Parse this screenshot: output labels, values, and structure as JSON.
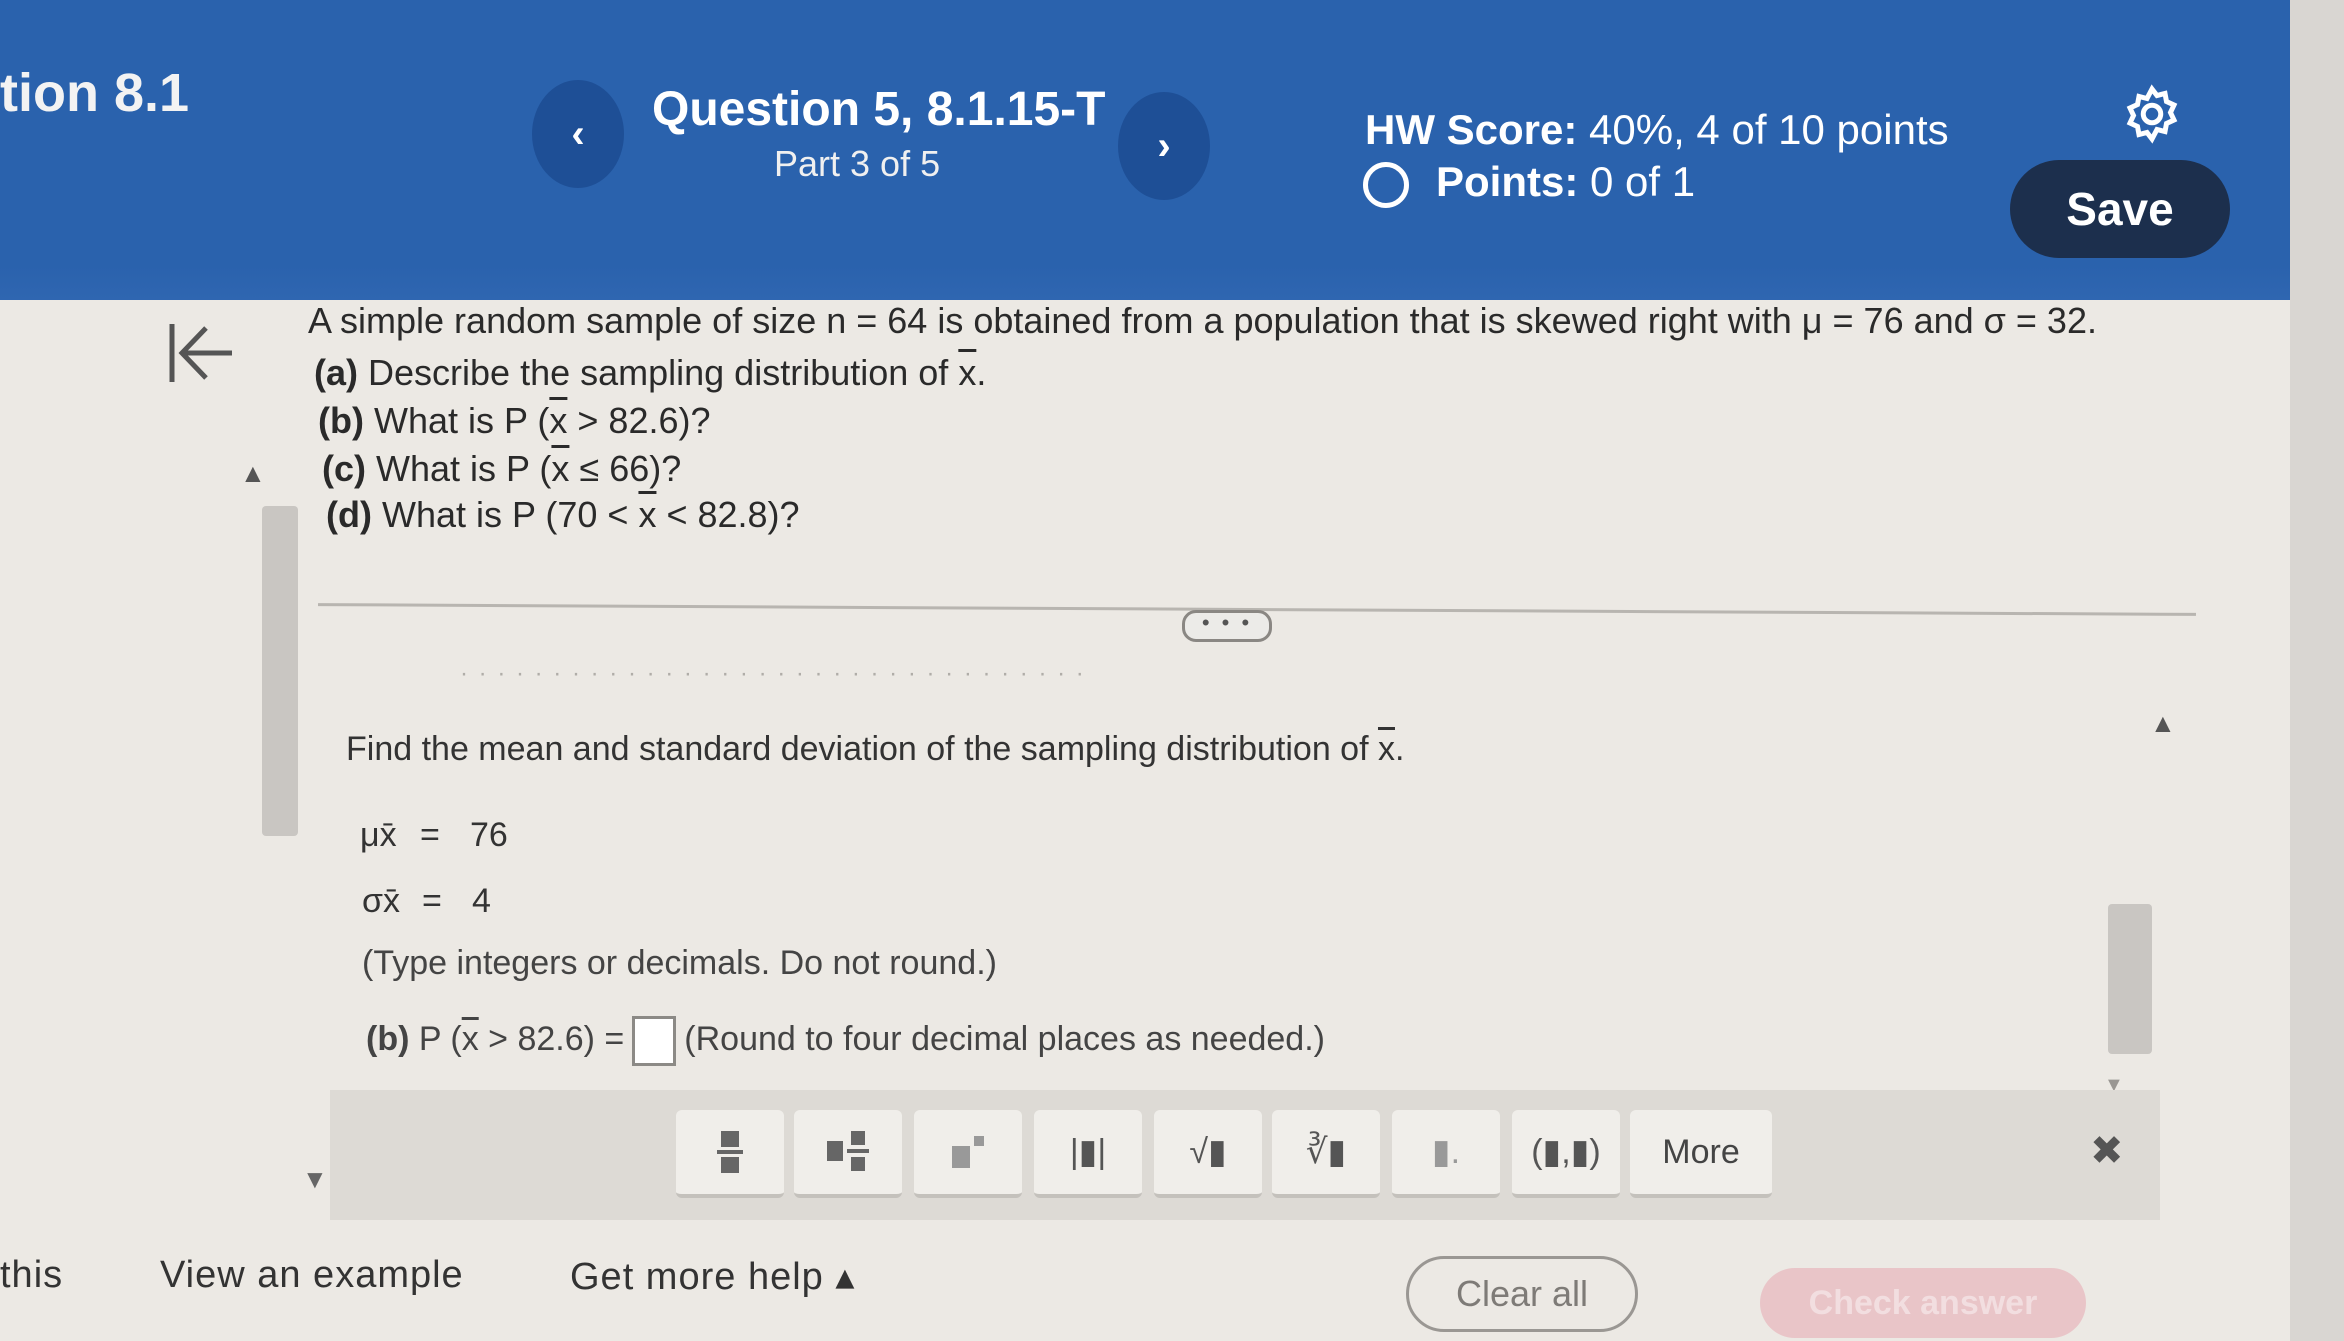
{
  "header": {
    "section_title": "tion 8.1",
    "question_title": "Question 5, 8.1.15-T",
    "part": "Part 3 of 5",
    "prev_label": "‹",
    "next_label": "›",
    "hw_score_label": "HW Score:",
    "hw_score_value": "40%, 4 of 10 points",
    "points_label": "Points:",
    "points_value": "0 of 1",
    "save_label": "Save",
    "settings_icon": "gear-icon",
    "color": "#2a62ad"
  },
  "question": {
    "intro": "A simple random sample of size n = 64 is obtained from a population that is skewed right with μ = 76 and σ = 32.",
    "part_a_label": "(a)",
    "part_a_text_1": "Describe the sampling distribution of",
    "part_a_x": "x",
    "part_a_text_2": ".",
    "part_b_label": "(b)",
    "part_b_text_1": "What is P",
    "part_b_open": "(",
    "part_b_x": "x",
    "part_b_text_2": "> 82.6)?",
    "part_c_label": "(c)",
    "part_c_text_1": "What is P",
    "part_c_open": "(",
    "part_c_x": "x",
    "part_c_text_2": "≤ 66)?",
    "part_d_label": "(d)",
    "part_d_text_1": "What is P (70 <",
    "part_d_x": "x",
    "part_d_text_2": "< 82.8)?"
  },
  "expand_handle": "• • •",
  "faded_line": "· · ·  · · · · · ·  · ·  · · ·  · · · · · · · · · ·  · ·  · · · · · · · ·",
  "answer": {
    "find_text_1": "Find the mean and standard deviation of the sampling distribution of",
    "find_x": "x",
    "find_text_2": ".",
    "mu_symbol": "μx̄",
    "mu_equals": "=",
    "mu_value": "76",
    "sigma_symbol": "σx̄",
    "sigma_equals": "=",
    "sigma_value": "4",
    "type_hint": "(Type integers or decimals. Do not round.)",
    "part_b_label": "(b)",
    "part_b_expr_1": "P (",
    "part_b_x": "x",
    "part_b_expr_2": "> 82.6) =",
    "part_b_hint": "(Round to four decimal places as needed.)"
  },
  "toolbar": {
    "buttons": [
      "fraction",
      "mixed-number",
      "exponent",
      "absolute-value",
      "square-root",
      "nth-root",
      "decimal",
      "interval"
    ],
    "abs_glyph": "|▮|",
    "sqrt_glyph": "√▮",
    "nthroot_glyph": "∛▮",
    "decimal_glyph": "▮.",
    "interval_glyph": "(▮,▮)",
    "more_label": "More",
    "close_glyph": "✖"
  },
  "bottom": {
    "this_label": "this",
    "example_label": "View an example",
    "help_label": "Get more help ▴",
    "clear_all_label": "Clear all",
    "check_answer_label": "Check answer",
    "check_answer_color": "#e9c5c8"
  }
}
